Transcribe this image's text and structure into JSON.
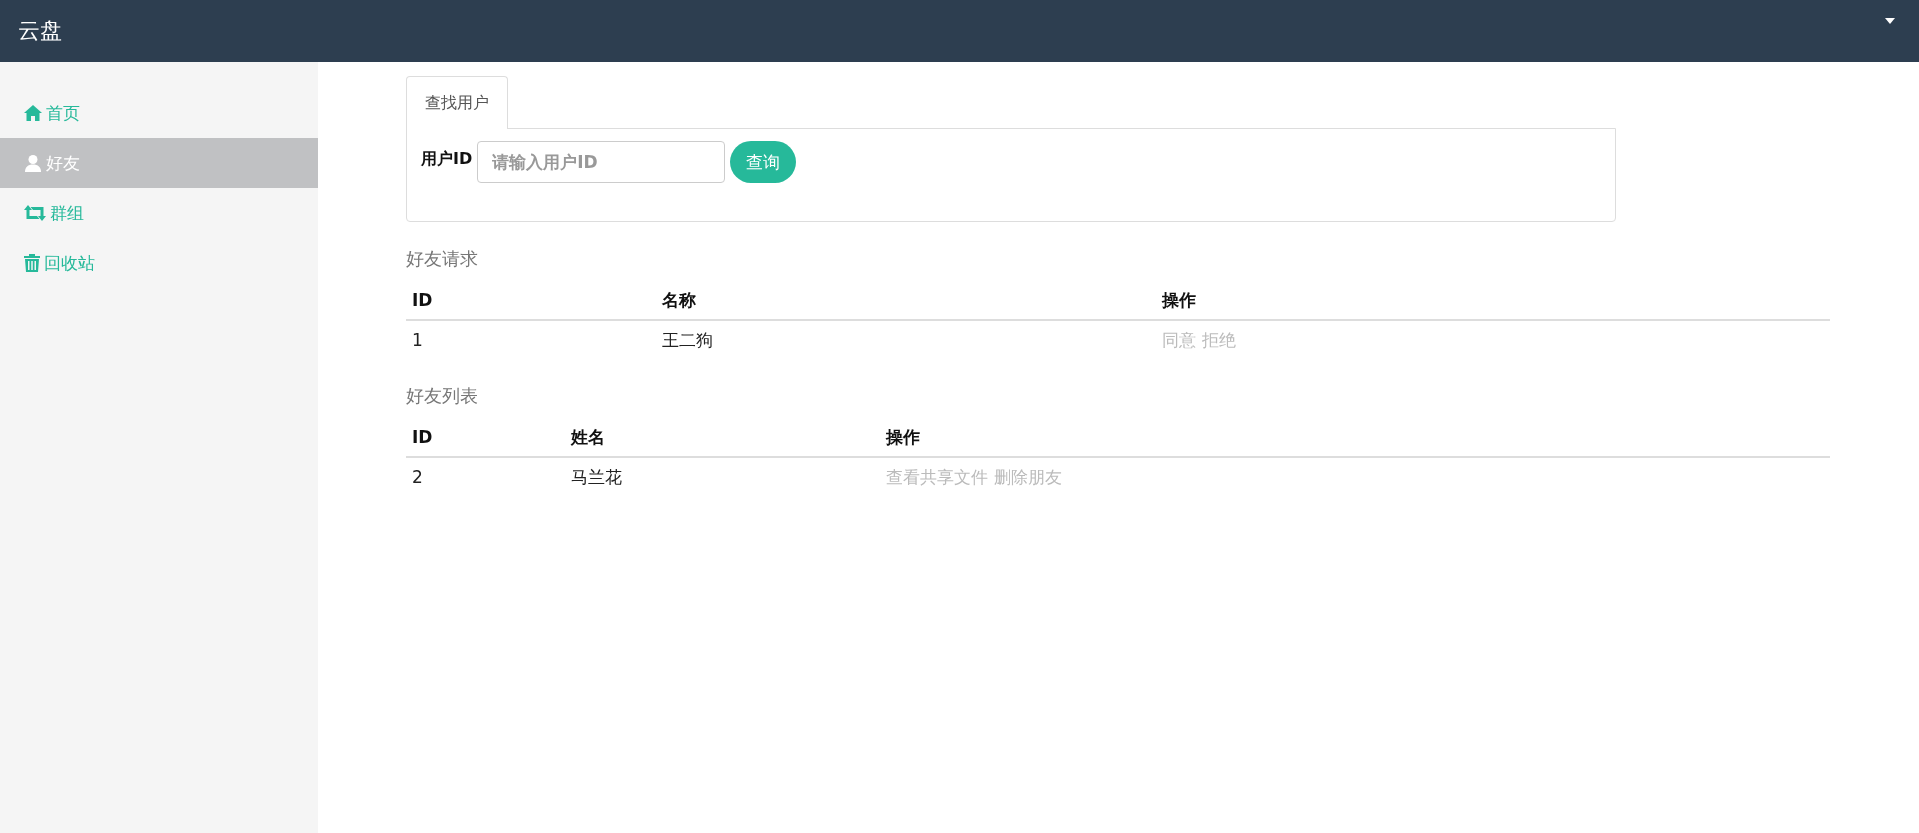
{
  "navbar": {
    "brand": "云盘"
  },
  "sidebar": {
    "items": [
      {
        "label": "首页",
        "selected": false
      },
      {
        "label": "好友",
        "selected": true
      },
      {
        "label": "群组",
        "selected": false
      },
      {
        "label": "回收站",
        "selected": false
      }
    ]
  },
  "search": {
    "tabs": [
      {
        "label": "查找用户",
        "selected": true
      }
    ],
    "field_label": "用户ID",
    "placeholder": "请输入用户ID",
    "button": "查询"
  },
  "sections": [
    {
      "title": "好友请求",
      "columns": [
        "ID",
        "名称",
        "操作"
      ],
      "rows": [
        {
          "cells": [
            "1",
            "王二狗"
          ],
          "actions": [
            "同意",
            "拒绝"
          ]
        }
      ]
    },
    {
      "title": "好友列表",
      "columns": [
        "ID",
        "姓名",
        "操作"
      ],
      "rows": [
        {
          "cells": [
            "2",
            "马兰花"
          ],
          "actions": [
            "查看共享文件",
            "删除朋友"
          ]
        }
      ]
    }
  ]
}
